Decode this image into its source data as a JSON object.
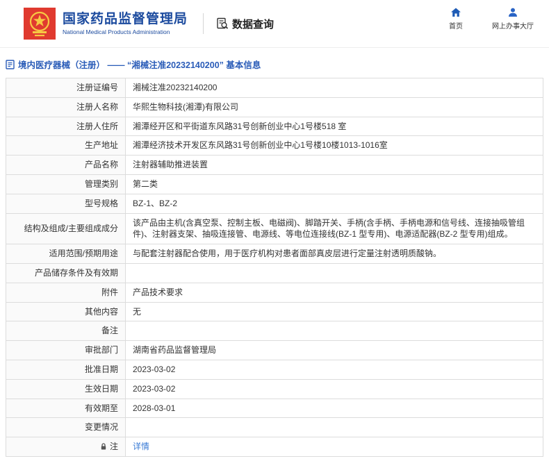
{
  "header": {
    "org_name_cn": "国家药品监督管理局",
    "org_name_en": "National Medical Products Administration",
    "section_title": "数据查询",
    "nav": [
      {
        "label": "首页",
        "icon": "home-icon"
      },
      {
        "label": "网上办事大厅",
        "icon": "person-icon"
      }
    ]
  },
  "breadcrumb": {
    "text": "境内医疗器械（注册） —— “湘械注准20232140200” 基本信息"
  },
  "colors": {
    "brand_blue": "#1b4a9e",
    "breadcrumb_blue": "#2a5cb8",
    "emblem_red": "#e03a2f",
    "emblem_gold": "#f7c843",
    "link_blue": "#3a7bd5",
    "border_gray": "#dcdcdc"
  },
  "table": {
    "rows": [
      {
        "label": "注册证编号",
        "value": "湘械注准20232140200"
      },
      {
        "label": "注册人名称",
        "value": "华熙生物科技(湘潭)有限公司"
      },
      {
        "label": "注册人住所",
        "value": "湘潭经开区和平街道东风路31号创新创业中心1号楼518 室"
      },
      {
        "label": "生产地址",
        "value": "湘潭经济技术开发区东风路31号创新创业中心1号楼10楼1013-1016室"
      },
      {
        "label": "产品名称",
        "value": "注射器辅助推进装置"
      },
      {
        "label": "管理类别",
        "value": "第二类"
      },
      {
        "label": "型号规格",
        "value": "BZ-1、BZ-2"
      },
      {
        "label": "结构及组成/主要组成成分",
        "value": "该产品由主机(含真空泵、控制主板、电磁阀)、脚踏开关、手柄(含手柄、手柄电源和信号线、连接抽吸管组件)、注射器支架、抽吸连接管、电源线、等电位连接线(BZ-1 型专用)、电源适配器(BZ-2 型专用)组成。"
      },
      {
        "label": "适用范围/预期用途",
        "value": "与配套注射器配合使用，用于医疗机构对患者面部真皮层进行定量注射透明质酸钠。"
      },
      {
        "label": "产品储存条件及有效期",
        "value": ""
      },
      {
        "label": "附件",
        "value": "产品技术要求"
      },
      {
        "label": "其他内容",
        "value": "无"
      },
      {
        "label": "备注",
        "value": ""
      },
      {
        "label": "审批部门",
        "value": "湖南省药品监督管理局"
      },
      {
        "label": "批准日期",
        "value": "2023-03-02"
      },
      {
        "label": "生效日期",
        "value": "2023-03-02"
      },
      {
        "label": "有效期至",
        "value": "2028-03-01"
      },
      {
        "label": "变更情况",
        "value": ""
      },
      {
        "label": "注",
        "value": "详情",
        "link": true,
        "icon": "lock-icon"
      }
    ]
  }
}
